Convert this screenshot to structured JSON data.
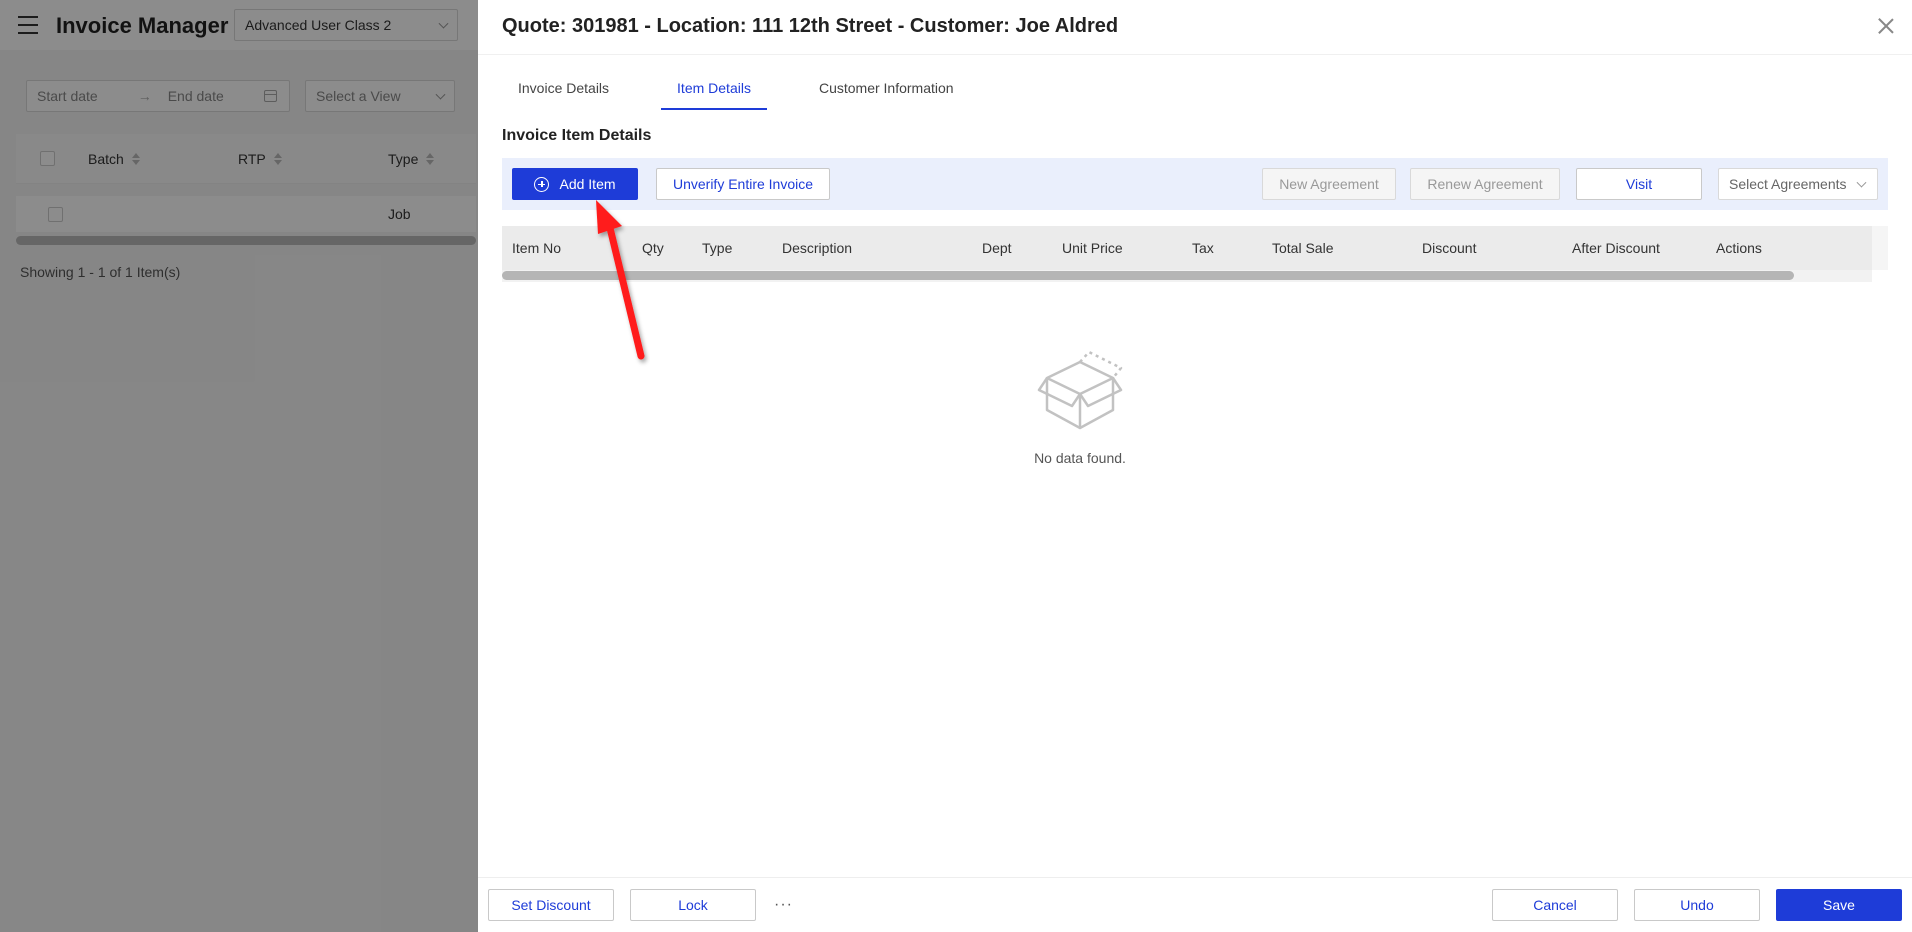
{
  "app": {
    "title": "Invoice Manager",
    "class_select": "Advanced User Class 2",
    "start_date_placeholder": "Start date",
    "end_date_placeholder": "End date",
    "date_arrow": "→",
    "view_select_placeholder": "Select a View",
    "table_headers": [
      "Batch",
      "RTP",
      "Type"
    ],
    "row_type": "Job",
    "footer": "Showing 1 - 1 of 1 Item(s)"
  },
  "drawer": {
    "title": "Quote: 301981 - Location: 111 12th Street - Customer: Joe Aldred",
    "tabs": [
      {
        "label": "Invoice Details",
        "active": false
      },
      {
        "label": "Item Details",
        "active": true
      },
      {
        "label": "Customer Information",
        "active": false
      }
    ],
    "section_title": "Invoice Item Details",
    "toolbar": {
      "add_item": "Add Item",
      "unverify": "Unverify Entire Invoice",
      "new_agreement": "New Agreement",
      "renew_agreement": "Renew Agreement",
      "visit": "Visit",
      "select_agreements_placeholder": "Select Agreements"
    },
    "columns": [
      "Item No",
      "Qty",
      "Type",
      "Description",
      "Dept",
      "Unit Price",
      "Tax",
      "Total Sale",
      "Discount",
      "After Discount",
      "Actions"
    ],
    "empty_text": "No data found.",
    "footer": {
      "set_discount": "Set Discount",
      "lock": "Lock",
      "more": "···",
      "cancel": "Cancel",
      "undo": "Undo",
      "save": "Save"
    }
  },
  "colors": {
    "primary": "#1e3cd8",
    "toolbar_bg": "#eaeffc",
    "annotation_arrow": "#ff1a1a"
  }
}
